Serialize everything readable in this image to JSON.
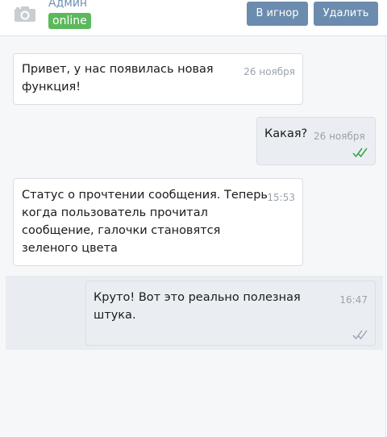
{
  "header": {
    "user_name": "Админ",
    "status": "online",
    "ignore_button": "В игнор",
    "delete_button": "Удалить"
  },
  "messages": [
    {
      "direction": "in",
      "text": "Привет, у нас появилась новая функция!",
      "time": "26 ноября"
    },
    {
      "direction": "out",
      "text": "Какая?",
      "time": "26 ноября",
      "read": true
    },
    {
      "direction": "in",
      "text": "Статус о прочтении сообщения. Теперь когда пользователь прочитал сообщение, галочки становятся зеленого цвета",
      "time": "15:53"
    },
    {
      "direction": "out",
      "text": "Круто! Вот это реально полезная штука.",
      "time": "16:47",
      "read": false
    }
  ],
  "colors": {
    "read_check": "#3fa34d",
    "unread_check": "#9aa2ab",
    "online_badge": "#5cb85c",
    "button": "#6b8cae"
  }
}
